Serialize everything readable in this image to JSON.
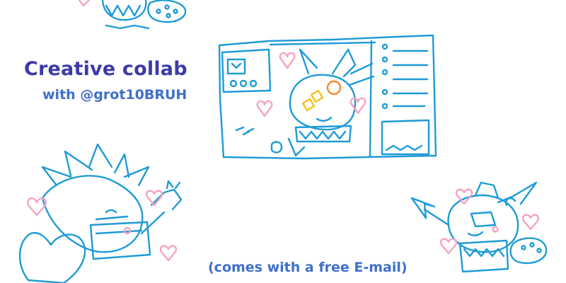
{
  "banner": {
    "title": "Creative collab",
    "subtitle": "with @grot10BRUH",
    "footnote": "(comes with a free E-mail)"
  },
  "colors": {
    "background": "#ffffff",
    "title": "#3d3aa8",
    "subtitle": "#3f6fc9",
    "doodle_line": "#1f9bd6",
    "heart": "#f4a3c3",
    "accent_orange": "#f5882a",
    "accent_yellow": "#f2c21b"
  },
  "illustrations": [
    "grot-doodle-top",
    "dashboard-with-grot-doodle",
    "grot-hugging-heart-doodle",
    "grot-with-phone-doodle"
  ]
}
